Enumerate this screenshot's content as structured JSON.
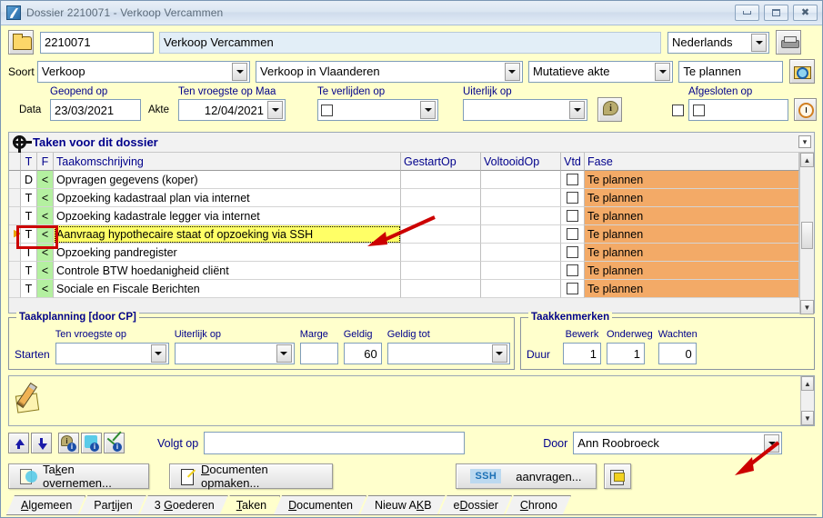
{
  "window": {
    "title": "Dossier 2210071 - Verkoop Vercammen",
    "icon": "quill-icon",
    "controls": {
      "minimize": "minimize-button",
      "restore": "restore-button",
      "close": "close-button"
    }
  },
  "header": {
    "open_folder_button": "open-folder-icon",
    "dossier_number": "2210071",
    "dossier_name": "Verkoop Vercammen",
    "language": "Nederlands",
    "print_button": "printer-icon",
    "soort_label": "Soort",
    "soort_value": "Verkoop",
    "region_value": "Verkoop in Vlaanderen",
    "akte_type_value": "Mutatieve akte",
    "status_value": "Te plannen",
    "search_button": "folder-search-icon",
    "data_label": "Data",
    "geopend_op_label": "Geopend op",
    "geopend_op_value": "23/03/2021",
    "akte_label": "Akte",
    "ten_vroegste_label": "Ten vroegste op Maa",
    "ten_vroegste_value": "12/04/2021",
    "te_verlijden_label": "Te verlijden op",
    "te_verlijden_value": "",
    "uiterlijk_label": "Uiterlijk op",
    "uiterlijk_value": "",
    "info_button": "info-balloon-icon",
    "afgesloten_label": "Afgesloten op",
    "afgesloten_value": "",
    "clock_button": "clock-icon"
  },
  "tasks_panel": {
    "title": "Taken voor dit dossier",
    "gear_icon": "gear-icon",
    "collapse_icon": "collapse-icon",
    "columns": [
      "T",
      "F",
      "Taakomschrijving",
      "GestartOp",
      "VoltooidOp",
      "Vtd",
      "Fase"
    ],
    "rows": [
      {
        "t": "D",
        "f": "<",
        "desc": "Opvragen gegevens (koper)",
        "gestart": "",
        "voltooid": "",
        "vtd": false,
        "fase": "Te plannen",
        "selected": false
      },
      {
        "t": "T",
        "f": "<",
        "desc": "Opzoeking kadastraal plan via internet",
        "gestart": "",
        "voltooid": "",
        "vtd": false,
        "fase": "Te plannen",
        "selected": false
      },
      {
        "t": "T",
        "f": "<",
        "desc": "Opzoeking kadastrale legger via internet",
        "gestart": "",
        "voltooid": "",
        "vtd": false,
        "fase": "Te plannen",
        "selected": false
      },
      {
        "t": "T",
        "f": "<",
        "desc": "Aanvraag hypothecaire staat of opzoeking via SSH",
        "gestart": "",
        "voltooid": "",
        "vtd": false,
        "fase": "Te plannen",
        "selected": true
      },
      {
        "t": "T",
        "f": "<",
        "desc": "Opzoeking pandregister",
        "gestart": "",
        "voltooid": "",
        "vtd": false,
        "fase": "Te plannen",
        "selected": false
      },
      {
        "t": "T",
        "f": "<",
        "desc": "Controle BTW hoedanigheid cliënt",
        "gestart": "",
        "voltooid": "",
        "vtd": false,
        "fase": "Te plannen",
        "selected": false
      },
      {
        "t": "T",
        "f": "<",
        "desc": "Sociale en Fiscale Berichten",
        "gestart": "",
        "voltooid": "",
        "vtd": false,
        "fase": "Te plannen",
        "selected": false
      }
    ]
  },
  "planning": {
    "title": "Taakplanning  [door CP]",
    "starten_label": "Starten",
    "ten_vroegste_label": "Ten vroegste op",
    "ten_vroegste_value": "",
    "uiterlijk_label": "Uiterlijk op",
    "uiterlijk_value": "",
    "marge_label": "Marge",
    "marge_value": "",
    "geldig_label": "Geldig",
    "geldig_value": "60",
    "geldig_tot_label": "Geldig tot",
    "geldig_tot_value": ""
  },
  "kenmerken": {
    "title": "Taakkenmerken",
    "duur_label": "Duur",
    "bewerk_label": "Bewerk",
    "bewerk_value": "1",
    "onderweg_label": "Onderweg",
    "onderweg_value": "1",
    "wachten_label": "Wachten",
    "wachten_value": "0"
  },
  "notes": {
    "pencil_icon": "pencil-note-icon",
    "text": ""
  },
  "bottom": {
    "move_up_icon": "arrow-up-icon",
    "move_down_icon": "arrow-down-icon",
    "info_icon": "info-balloon-icon",
    "config_icon": "gear-info-icon",
    "check_icon": "check-info-icon",
    "volgt_op_label": "Volgt op",
    "volgt_op_value": "",
    "door_label": "Door",
    "door_value": "Ann Roobroeck",
    "taken_overnemen_label": "Taken overnemen...",
    "documenten_opmaken_label": "Documenten opmaken...",
    "ssh_logo": "SSH",
    "aanvragen_label": "aanvragen...",
    "clipboard_icon": "clipboard-icon"
  },
  "tabs": [
    {
      "label": "Algemeen",
      "active": false
    },
    {
      "label": "Partijen",
      "active": false
    },
    {
      "label": "3 Goederen",
      "active": false
    },
    {
      "label": "Taken",
      "active": true
    },
    {
      "label": "Documenten",
      "active": false
    },
    {
      "label": "Nieuw AKB",
      "active": false
    },
    {
      "label": "eDossier",
      "active": false
    },
    {
      "label": "Chrono",
      "active": false
    }
  ],
  "annotations": {
    "arrow_color": "#cc0000",
    "highlight_box_color": "#cc0000",
    "arrow_task_row": "points-to-selected-task-row",
    "arrow_ssh_button": "points-to-ssh-aanvragen-button"
  },
  "colors": {
    "window_bg": "#ffffcc",
    "selected_row": "#ffff66",
    "fase_cell": "#f3aa67",
    "flag_cell": "#b4f0a0",
    "label_blue": "#00008b"
  }
}
